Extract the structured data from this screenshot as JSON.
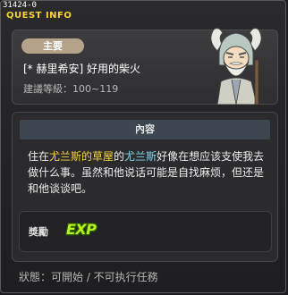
{
  "window": {
    "quest_id": "31424-0",
    "title": "QUEST INFO"
  },
  "header": {
    "category": "主要",
    "quest_name": "[* 赫里希安] 好用的柴火",
    "level_requirement": "建議等級：100~119"
  },
  "content": {
    "section_title": "內容",
    "description": {
      "p1": "住在",
      "p2": "尤兰斯的草屋",
      "p3": "的",
      "p4": "尤兰斯",
      "p5": "好像在想应该支使我去做什么事。虽然和他说话可能是自找麻烦，但还是和他谈谈吧。"
    }
  },
  "reward": {
    "label": "獎勵",
    "exp_icon_text": "EXP"
  },
  "status": {
    "text": "狀態：可開始 / 不可执行任務"
  },
  "colors": {
    "title": "#f5d33b",
    "highlight_place": "#f7d23c",
    "highlight_npc": "#7ed6ee",
    "category_badge": "#b4a38a",
    "exp": "#b5f21e"
  },
  "icons": {
    "npc_portrait": "old-sage-npc-portrait",
    "exp": "exp-icon"
  }
}
